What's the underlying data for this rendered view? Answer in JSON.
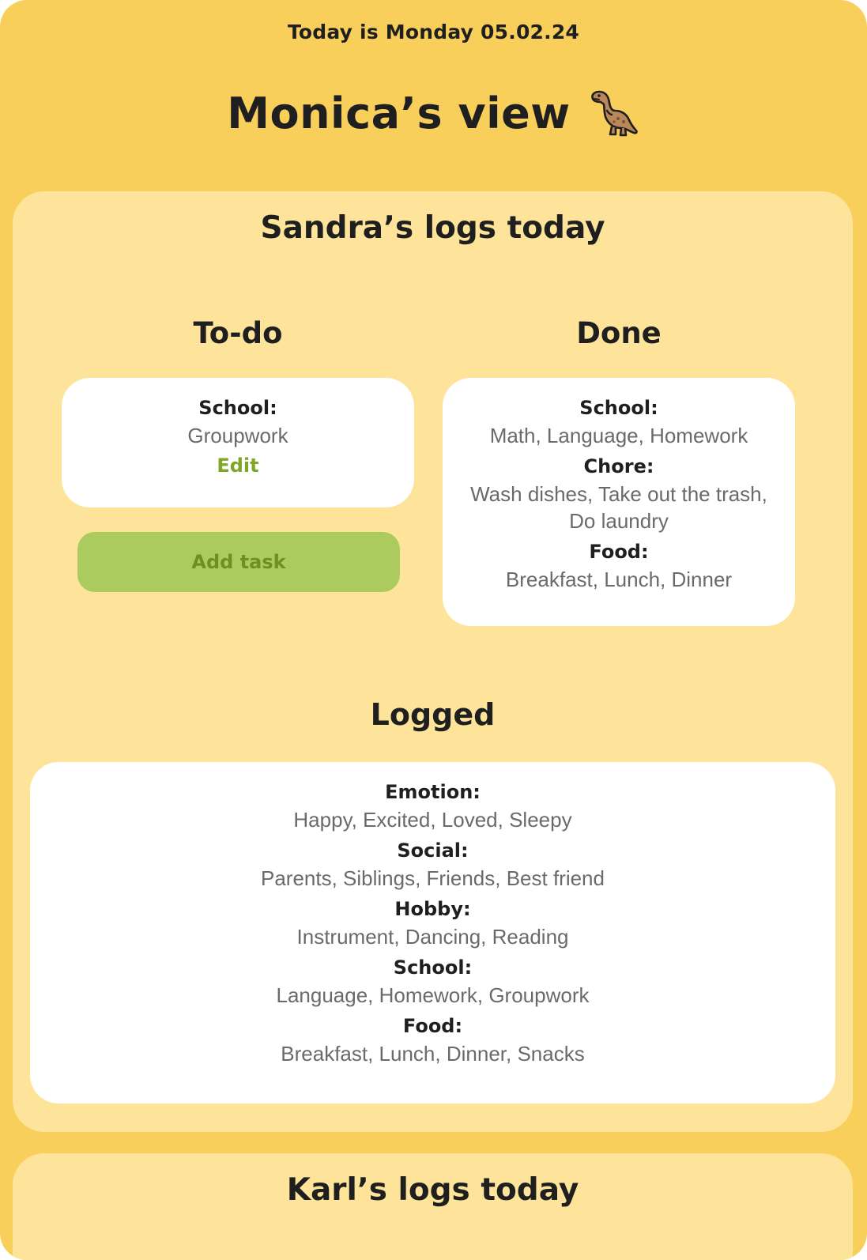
{
  "header": {
    "date_text": "Today is Monday 05.02.24",
    "view_title": "Monica’s view",
    "title_icon": "dinosaur-icon"
  },
  "colors": {
    "page_bg": "#f9cf5c",
    "panel_bg": "#fee49a",
    "card_bg": "#ffffff",
    "accent_green": "#abcb5e",
    "edit_green": "#7fa626"
  },
  "sandra": {
    "title": "Sandra’s logs today",
    "todo": {
      "heading": "To-do",
      "sections": [
        {
          "label": "School:",
          "items": "Groupwork"
        }
      ],
      "edit_label": "Edit",
      "add_task_label": "Add task"
    },
    "done": {
      "heading": "Done",
      "sections": [
        {
          "label": "School:",
          "items": "Math, Language, Homework"
        },
        {
          "label": "Chore:",
          "items_line1": "Wash dishes, Take out the trash,",
          "items_line2": "Do laundry"
        },
        {
          "label": "Food:",
          "items": "Breakfast, Lunch, Dinner"
        }
      ]
    },
    "logged": {
      "heading": "Logged",
      "sections": [
        {
          "label": "Emotion:",
          "items": "Happy, Excited, Loved, Sleepy"
        },
        {
          "label": "Social:",
          "items": "Parents, Siblings, Friends, Best friend"
        },
        {
          "label": "Hobby:",
          "items": "Instrument, Dancing, Reading"
        },
        {
          "label": "School:",
          "items": "Language, Homework, Groupwork"
        },
        {
          "label": "Food:",
          "items": "Breakfast, Lunch, Dinner, Snacks"
        }
      ]
    }
  },
  "karl": {
    "title": "Karl’s logs today"
  }
}
